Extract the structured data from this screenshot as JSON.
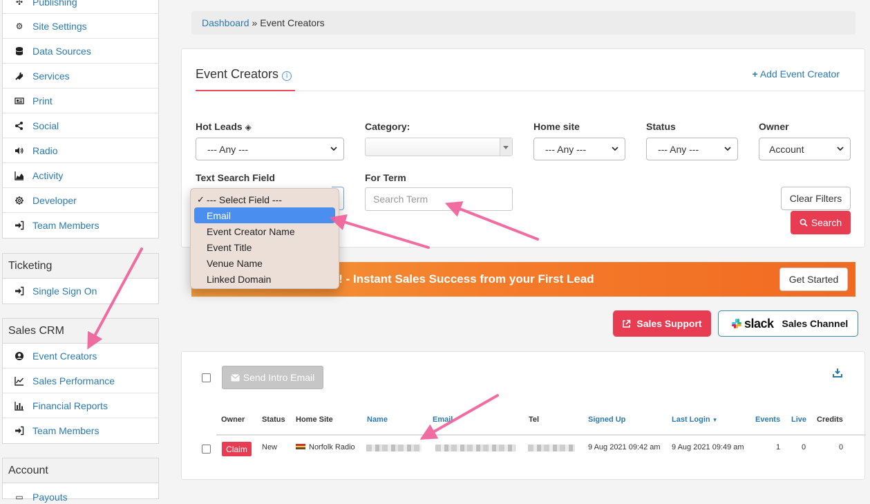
{
  "sidebar": {
    "top_items": [
      {
        "label": "Publishing",
        "icon": "publishing-icon"
      },
      {
        "label": "Site Settings",
        "icon": "gears-icon"
      },
      {
        "label": "Data Sources",
        "icon": "database-icon"
      },
      {
        "label": "Services",
        "icon": "plug-icon"
      },
      {
        "label": "Print",
        "icon": "newspaper-icon"
      },
      {
        "label": "Social",
        "icon": "share-icon"
      },
      {
        "label": "Radio",
        "icon": "volume-icon"
      },
      {
        "label": "Activity",
        "icon": "area-chart-icon"
      },
      {
        "label": "Developer",
        "icon": "cog-icon"
      },
      {
        "label": "Team Members",
        "icon": "sign-in-icon"
      }
    ],
    "ticketing": {
      "title": "Ticketing",
      "items": [
        {
          "label": "Single Sign On"
        }
      ]
    },
    "sales_crm": {
      "title": "Sales CRM",
      "items": [
        {
          "label": "Event Creators"
        },
        {
          "label": "Sales Performance"
        },
        {
          "label": "Financial Reports"
        },
        {
          "label": "Team Members"
        }
      ]
    },
    "account": {
      "title": "Account",
      "items": [
        {
          "label": "Payouts"
        }
      ]
    }
  },
  "breadcrumb": {
    "home": "Dashboard",
    "separator": "»",
    "current": "Event Creators"
  },
  "header": {
    "title": "Event Creators",
    "add_label": "Add Event Creator"
  },
  "filters": {
    "hot_leads": {
      "label": "Hot Leads",
      "value": "--- Any ---"
    },
    "category": {
      "label": "Category:",
      "value": ""
    },
    "home_site": {
      "label": "Home site",
      "value": "--- Any ---"
    },
    "status": {
      "label": "Status",
      "value": "--- Any ---"
    },
    "owner": {
      "label": "Owner",
      "value": "Account"
    },
    "text_search_field": {
      "label": "Text Search Field"
    },
    "for_term": {
      "label": "For Term",
      "placeholder": "Search Term"
    },
    "clear_label": "Clear Filters",
    "search_label": "Search"
  },
  "dropdown": {
    "options": [
      "--- Select Field ---",
      "Email",
      "Event Creator Name",
      "Event Title",
      "Venue Name",
      "Linked Domain"
    ],
    "checked_index": 0,
    "highlighted_index": 1
  },
  "banner": {
    "text": "s HERO! - Instant Sales Success from your First Lead",
    "button_label": "Get Started"
  },
  "support": {
    "sales_support_label": "Sales Support",
    "slack_label": "slack",
    "slack_channel_label": "Sales Channel"
  },
  "table": {
    "send_intro_label": "Send Intro Email",
    "columns": [
      "Owner",
      "Status",
      "Home Site",
      "Name",
      "Email",
      "Tel",
      "Signed Up",
      "Last Login",
      "Events",
      "Live",
      "Credits"
    ],
    "rows": [
      {
        "owner_action": "Claim",
        "status": "New",
        "home_site": "Norfolk Radio",
        "signed_up": "9 Aug 2021 09:42 am",
        "last_login": "9 Aug 2021 09:49 am",
        "events": "1",
        "live": "0",
        "credits": "0"
      }
    ]
  },
  "colors": {
    "accent_red": "#e83c52",
    "link_blue": "#2a7ab0",
    "banner_orange": "#f57c2a",
    "arrow_pink": "#f0609a"
  }
}
